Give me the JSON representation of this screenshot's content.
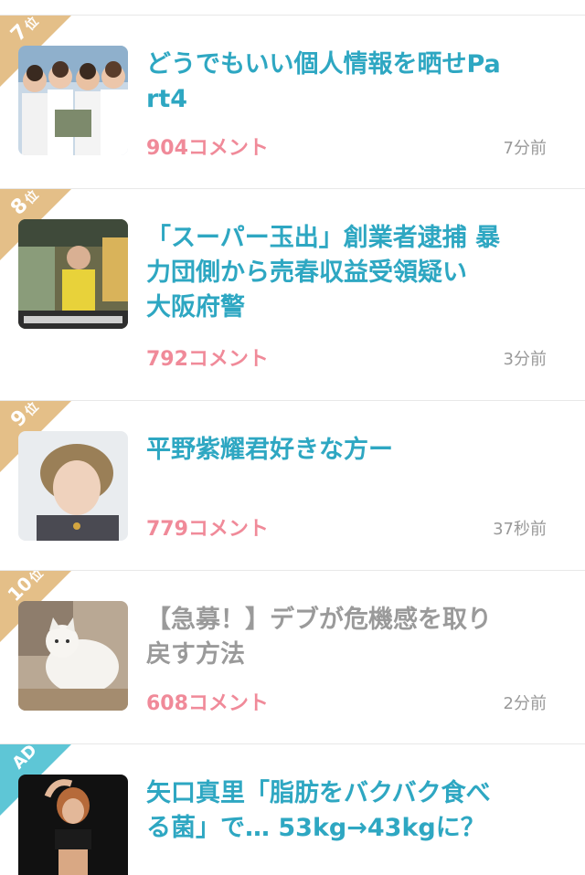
{
  "items": [
    {
      "rank": "7",
      "rank_suffix": "位",
      "title": "どうでもいい個人情報を晒せPart4",
      "comments": "904コメント",
      "time": "7分前",
      "thumb": "group-photo-thumbnail"
    },
    {
      "rank": "8",
      "rank_suffix": "位",
      "title": "「スーパー玉出」創業者逮捕 暴力団側から売春収益受領疑い　大阪府警",
      "comments": "792コメント",
      "time": "3分前",
      "thumb": "store-news-thumbnail"
    },
    {
      "rank": "9",
      "rank_suffix": "位",
      "title": "平野紫耀君好きな方ー",
      "comments": "779コメント",
      "time": "37秒前",
      "thumb": "portrait-thumbnail"
    },
    {
      "rank": "10",
      "rank_suffix": "位",
      "title": "【急募！】デブが危機感を取り戻す方法",
      "comments": "608コメント",
      "time": "2分前",
      "thumb": "cat-thumbnail"
    },
    {
      "rank": "AD",
      "rank_suffix": "",
      "title": "矢口真里「脂肪をバクバク食べる菌」で… 53kg→43kgに？",
      "thumb": "fitness-ad-thumbnail"
    }
  ],
  "colors": {
    "rank_ribbon": "#e4bf88",
    "ad_ribbon": "#5ec6d6",
    "title_active": "#2ea7c2",
    "title_visited": "#9a9a9a",
    "comments": "#f08a99",
    "divider": "#e8e8e8"
  }
}
